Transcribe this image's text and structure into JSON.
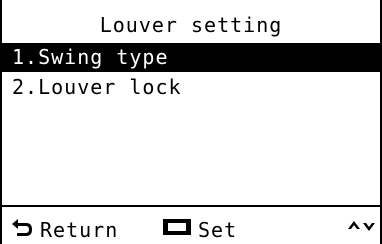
{
  "screen": {
    "title": "Louver setting"
  },
  "menu": {
    "items": [
      {
        "label": "1.Swing type",
        "selected": true
      },
      {
        "label": "2.Louver lock",
        "selected": false
      }
    ]
  },
  "footer": {
    "return_label": "Return",
    "return_icon": "return-arrow-icon",
    "set_label": "Set",
    "set_icon": "set-button-icon",
    "nav_icon": "up-down-arrows-icon"
  }
}
